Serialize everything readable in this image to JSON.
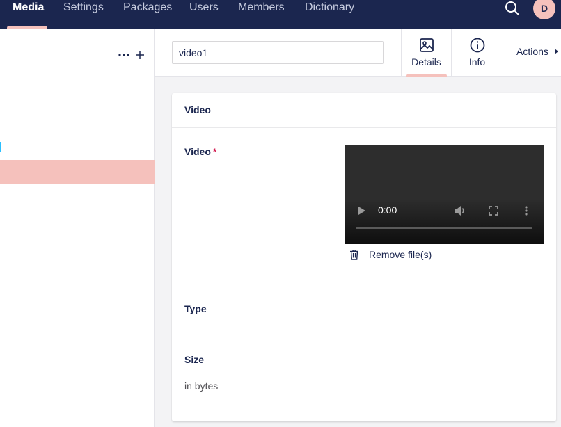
{
  "nav": {
    "items": [
      {
        "label": "Media",
        "active": true
      },
      {
        "label": "Settings",
        "active": false
      },
      {
        "label": "Packages",
        "active": false
      },
      {
        "label": "Users",
        "active": false
      },
      {
        "label": "Members",
        "active": false
      },
      {
        "label": "Dictionary",
        "active": false
      }
    ],
    "search_icon": "search-icon",
    "avatar_initial": "D"
  },
  "tree": {
    "more_icon": "ellipsis-icon",
    "add_icon": "plus-icon"
  },
  "editor": {
    "name_value": "video1",
    "apps": [
      {
        "label": "Details",
        "icon": "image-icon",
        "active": true
      },
      {
        "label": "Info",
        "icon": "info-icon",
        "active": false
      }
    ],
    "actions_label": "Actions"
  },
  "card": {
    "title": "Video",
    "properties": {
      "video": {
        "label": "Video",
        "required_mark": "*",
        "player": {
          "time": "0:00",
          "progress": 0
        },
        "remove_label": "Remove file(s)"
      },
      "type": {
        "label": "Type"
      },
      "size": {
        "label": "Size",
        "description": "in bytes"
      }
    }
  },
  "colors": {
    "header_bg": "#1b264f",
    "accent": "#f5c1bc",
    "required": "#d42054",
    "tree_marker": "#2bc0ff"
  }
}
